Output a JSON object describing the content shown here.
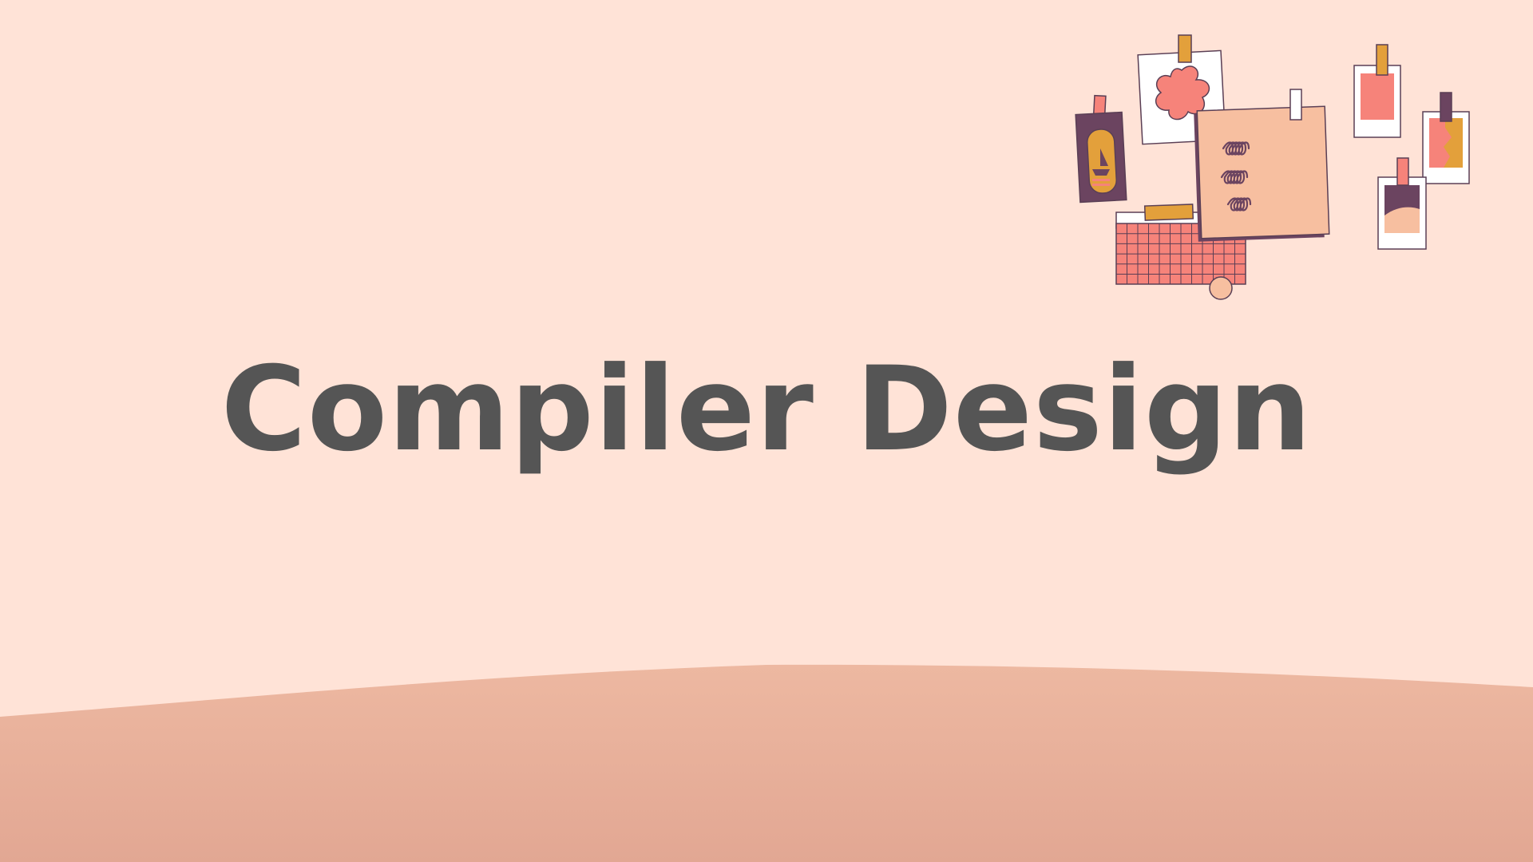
{
  "slide": {
    "title": "Compiler Design"
  },
  "colors": {
    "background": "#FFE3D7",
    "ground_top": "#EDB8A1",
    "ground_bottom": "#E2A793",
    "title_text": "#555555",
    "coral": "#F6837A",
    "plum": "#6B4460",
    "mustard": "#E3A03B",
    "peach": "#F7BFA0",
    "white": "#FFFFFF",
    "outline": "#5A3F55"
  },
  "illustration": {
    "name": "pinned-moodboard-illustration",
    "items": [
      "framed-poster",
      "flower-card",
      "note-paper",
      "calendar-grid",
      "small-photo-top",
      "small-photo-right",
      "small-photo-bottom"
    ]
  }
}
